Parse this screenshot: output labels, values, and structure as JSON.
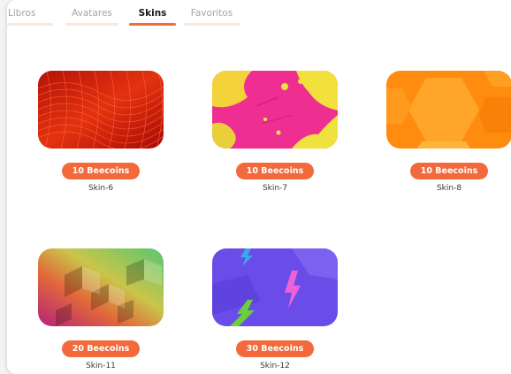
{
  "tabs": [
    {
      "label": "Libros",
      "active": false
    },
    {
      "label": "Avatares",
      "active": false
    },
    {
      "label": "Skins",
      "active": true
    },
    {
      "label": "Favoritos",
      "active": false
    }
  ],
  "skins": [
    {
      "price": "10 Beecoins",
      "name": "Skin-6",
      "icon": "red-wave-mesh-thumbnail"
    },
    {
      "price": "10 Beecoins",
      "name": "Skin-7",
      "icon": "pink-yellow-splatter-thumbnail"
    },
    {
      "price": "10 Beecoins",
      "name": "Skin-8",
      "icon": "orange-hexagon-thumbnail"
    },
    {
      "price": "20 Beecoins",
      "name": "Skin-11",
      "icon": "gradient-blocks-thumbnail"
    },
    {
      "price": "30 Beecoins",
      "name": "Skin-12",
      "icon": "purple-lightning-thumbnail"
    }
  ],
  "colors": {
    "accent": "#f26a3c",
    "tab_inactive_bar": "#fbe5dc"
  }
}
